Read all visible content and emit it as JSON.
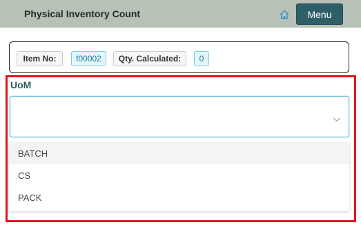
{
  "header": {
    "title": "Physical Inventory Count",
    "home_icon": "home-icon",
    "menu_label": "Menu"
  },
  "info": {
    "item_no_label": "Item No:",
    "item_no_value": "f00002",
    "qty_label": "Qty. Calculated:",
    "qty_value": "0"
  },
  "uom": {
    "label": "UoM",
    "selected_value": "",
    "options": [
      {
        "label": "BATCH"
      },
      {
        "label": "CS"
      },
      {
        "label": "PACK"
      }
    ]
  },
  "colors": {
    "header_bg": "#b7c1b5",
    "menu_bg": "#2e5f68",
    "highlight_border": "#e0141c",
    "focus_border": "#5eb5d0"
  }
}
